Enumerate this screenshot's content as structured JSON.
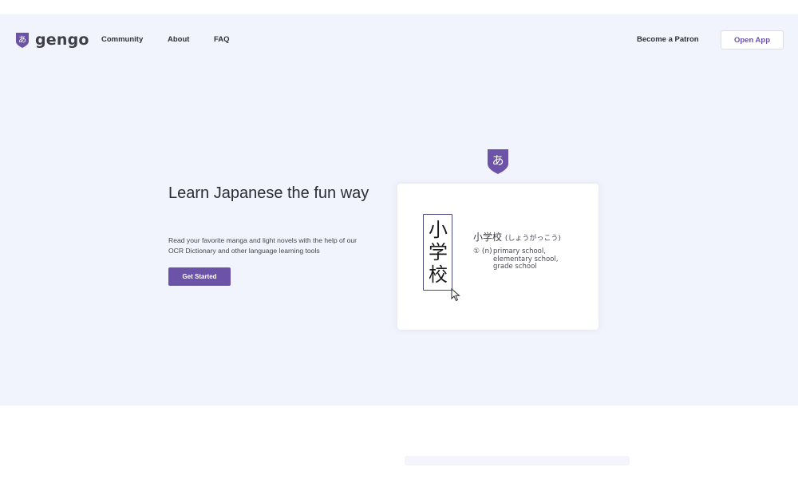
{
  "brand": {
    "name": "gengo",
    "badge_glyph": "あ",
    "accent": "#6c53a8"
  },
  "nav": {
    "links": [
      "Community",
      "About",
      "FAQ"
    ],
    "patron_label": "Become a Patron",
    "open_app_label": "Open App"
  },
  "hero": {
    "headline": "Learn Japanese the fun way",
    "subtext": "Read your favorite manga and light novels with the help of our OCR Dictionary and other language learning tools",
    "cta_label": "Get Started",
    "background": "#f1f3fd"
  },
  "demo": {
    "badge_glyph": "あ",
    "kanji": [
      "小",
      "学",
      "校"
    ],
    "word": "小学校",
    "reading": "(しょうがっこう)",
    "def_marker": "① (n)",
    "definitions": [
      "primary school,",
      "elementary school,",
      "grade school"
    ]
  }
}
